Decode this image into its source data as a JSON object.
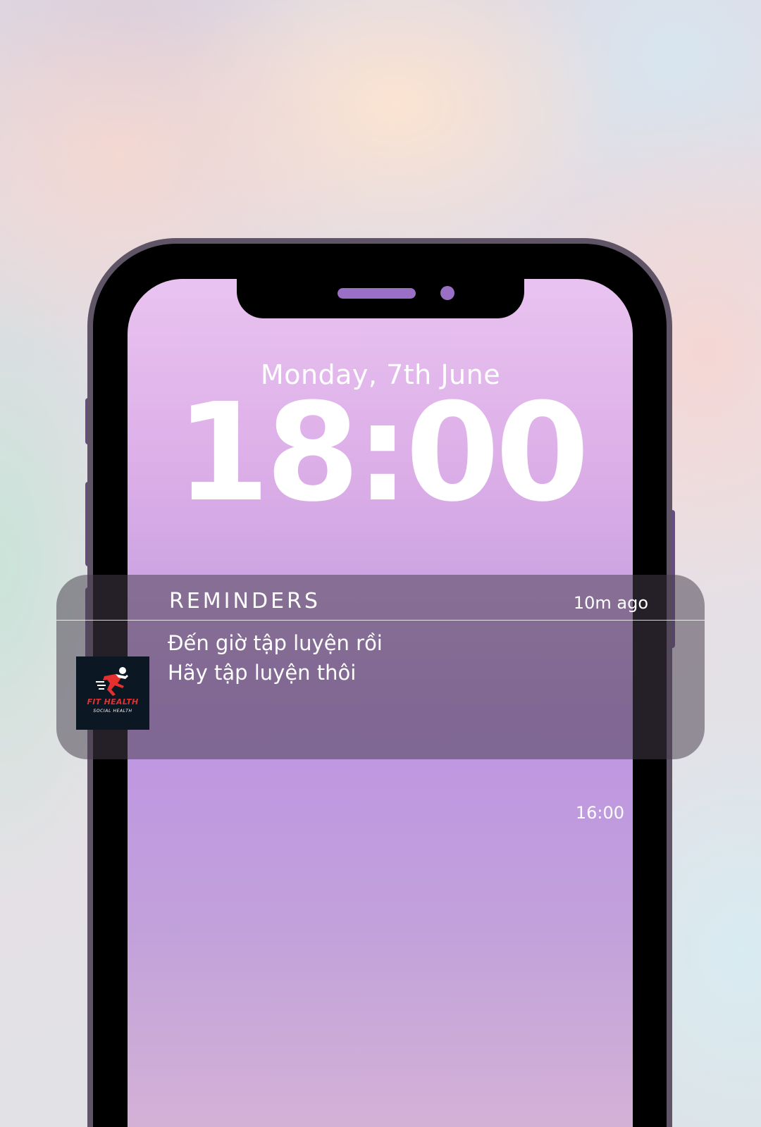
{
  "lock_screen": {
    "date": "Monday, 7th June",
    "time": "18:00"
  },
  "notification": {
    "app_name": "REMINDERS",
    "time_ago": "10m ago",
    "line1": "Đến giờ tập luyện rồi",
    "line2": "Hãy tập luyện thôi",
    "icon": {
      "name": "FIT HEALTH",
      "subtitle": "SOCIAL HEALTH",
      "glyph": "runner-icon"
    }
  },
  "older_notification": {
    "time": "16:00"
  },
  "colors": {
    "frame": "#000000",
    "frame_border": "#5f5566",
    "accent_purple": "#9a6fc6",
    "icon_red": "#e53030",
    "icon_bg": "#0b1722"
  }
}
